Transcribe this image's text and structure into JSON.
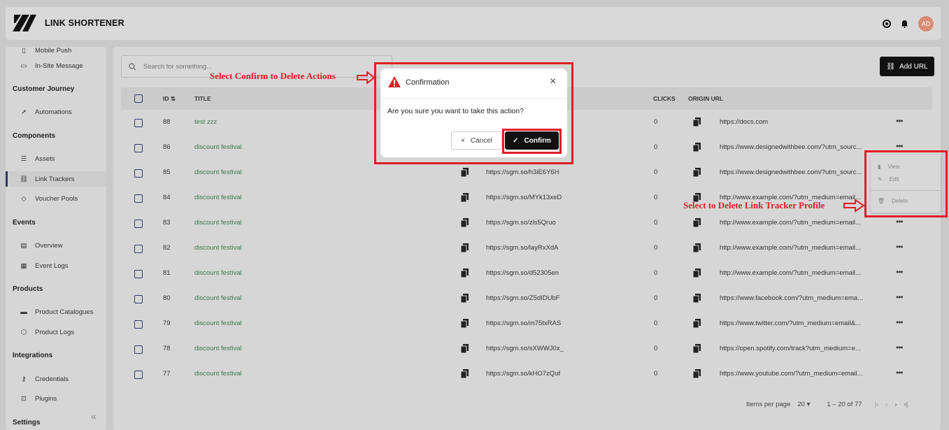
{
  "header": {
    "brand": "LINK SHORTENER",
    "avatar": "AD"
  },
  "sidebar": {
    "top_items": [
      {
        "label": "Mobile Push",
        "icon": "phone-icon"
      },
      {
        "label": "In-Site Message",
        "icon": "message-icon"
      }
    ],
    "sections": [
      {
        "title": "Customer Journey",
        "items": [
          {
            "label": "Automations",
            "icon": "rocket-icon"
          }
        ]
      },
      {
        "title": "Components",
        "items": [
          {
            "label": "Assets",
            "icon": "database-icon"
          },
          {
            "label": "Link Trackers",
            "icon": "link-icon",
            "active": true
          },
          {
            "label": "Voucher Pools",
            "icon": "tag-icon"
          }
        ]
      },
      {
        "title": "Events",
        "items": [
          {
            "label": "Overview",
            "icon": "chart-icon"
          },
          {
            "label": "Event Logs",
            "icon": "calendar-icon"
          }
        ]
      },
      {
        "title": "Products",
        "items": [
          {
            "label": "Product Catalogues",
            "icon": "catalogue-icon"
          },
          {
            "label": "Product Logs",
            "icon": "box-icon"
          }
        ]
      },
      {
        "title": "Integrations",
        "items": [
          {
            "label": "Credentials",
            "icon": "key-icon"
          },
          {
            "label": "Plugins",
            "icon": "plugin-icon"
          }
        ]
      },
      {
        "title": "Settings",
        "items": []
      }
    ]
  },
  "toolbar": {
    "search_placeholder": "Search for something...",
    "add_url": "Add URL"
  },
  "table": {
    "headers": {
      "id": "ID",
      "title": "TITLE",
      "clicks": "CLICKS",
      "origin": "ORIGIN URL"
    },
    "rows": [
      {
        "id": "88",
        "title": "test zzz",
        "short": "",
        "clicks": "0",
        "origin": "https://docs.com"
      },
      {
        "id": "86",
        "title": "discount festival",
        "short": "",
        "clicks": "0",
        "origin": "https://www.designedwithbee.com/?utm_sourc..."
      },
      {
        "id": "85",
        "title": "discount festival",
        "short": "https://sgm.so/h3iE6Y6H",
        "clicks": "0",
        "origin": "https://www.designedwithbee.com/?utm_sourc..."
      },
      {
        "id": "84",
        "title": "discount festival",
        "short": "https://sgm.so/MYk13xeD",
        "clicks": "0",
        "origin": "http://www.example.com/?utm_medium=email..."
      },
      {
        "id": "83",
        "title": "discount festival",
        "short": "https://sgm.so/zls5Qruo",
        "clicks": "0",
        "origin": "http://www.example.com/?utm_medium=email..."
      },
      {
        "id": "82",
        "title": "discount festival",
        "short": "https://sgm.so/layRxXdA",
        "clicks": "0",
        "origin": "http://www.example.com/?utm_medium=email..."
      },
      {
        "id": "81",
        "title": "discount festival",
        "short": "https://sgm.so/d52305en",
        "clicks": "0",
        "origin": "http://www.example.com/?utm_medium=email..."
      },
      {
        "id": "80",
        "title": "discount festival",
        "short": "https://sgm.so/Z5dIDUbF",
        "clicks": "0",
        "origin": "https://www.facebook.com/?utm_medium=ema..."
      },
      {
        "id": "79",
        "title": "discount festival",
        "short": "https://sgm.so/m75txRAS",
        "clicks": "0",
        "origin": "https://www.twitter.com/?utm_medium=email&..."
      },
      {
        "id": "78",
        "title": "discount festival",
        "short": "https://sgm.so/sXWWJ0x_",
        "clicks": "0",
        "origin": "https://open.spotify.com/track?utm_medium=e..."
      },
      {
        "id": "77",
        "title": "discount festival",
        "short": "https://sgm.so/kHO7zQuf",
        "clicks": "0",
        "origin": "https://www.youtube.com/?utm_medium=email..."
      }
    ]
  },
  "pagination": {
    "items_per_page_label": "Items per page",
    "items_per_page": "20",
    "range": "1 – 20 of 77"
  },
  "context_menu": {
    "view": "View",
    "edit": "Edit",
    "delete": "Delete"
  },
  "modal": {
    "title": "Confirmation",
    "message": "Are you sure you want to take this action?",
    "cancel": "Cancel",
    "confirm": "Confirm"
  },
  "annotations": {
    "confirm_note": "Select Confirm to Delete Actions",
    "delete_note": "Select to Delete Link Tracker Profile",
    "color": "#e01f26"
  }
}
